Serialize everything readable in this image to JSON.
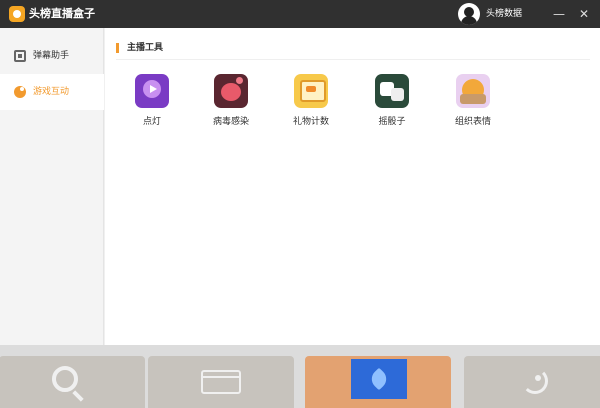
{
  "app": {
    "title": "头榜直播盒子",
    "user_name": "头榜数据",
    "minimize_glyph": "—",
    "close_glyph": "✕"
  },
  "sidebar": {
    "items": [
      {
        "label": "弹幕助手",
        "icon": "tv-icon",
        "active": false
      },
      {
        "label": "游戏互动",
        "icon": "game-icon",
        "active": true
      }
    ]
  },
  "main": {
    "section_title": "主播工具",
    "tools": [
      {
        "label": "点灯",
        "icon": "lamp-icon"
      },
      {
        "label": "病毒感染",
        "icon": "virus-icon"
      },
      {
        "label": "礼物计数",
        "icon": "gift-counter-icon"
      },
      {
        "label": "摇骰子",
        "icon": "dice-icon"
      },
      {
        "label": "组织表情",
        "icon": "emoji-icon"
      }
    ]
  },
  "dock": {
    "cards": [
      {
        "icon": "magnifier-icon"
      },
      {
        "icon": "browser-window-icon"
      },
      {
        "icon": "rocket-icon",
        "highlighted": true
      },
      {
        "icon": "satellite-dish-icon"
      }
    ]
  },
  "colors": {
    "accent": "#f29a2e",
    "titlebar": "#303030",
    "dock_highlight": "#e3a271",
    "rocket_tile": "#2d6ad8"
  }
}
